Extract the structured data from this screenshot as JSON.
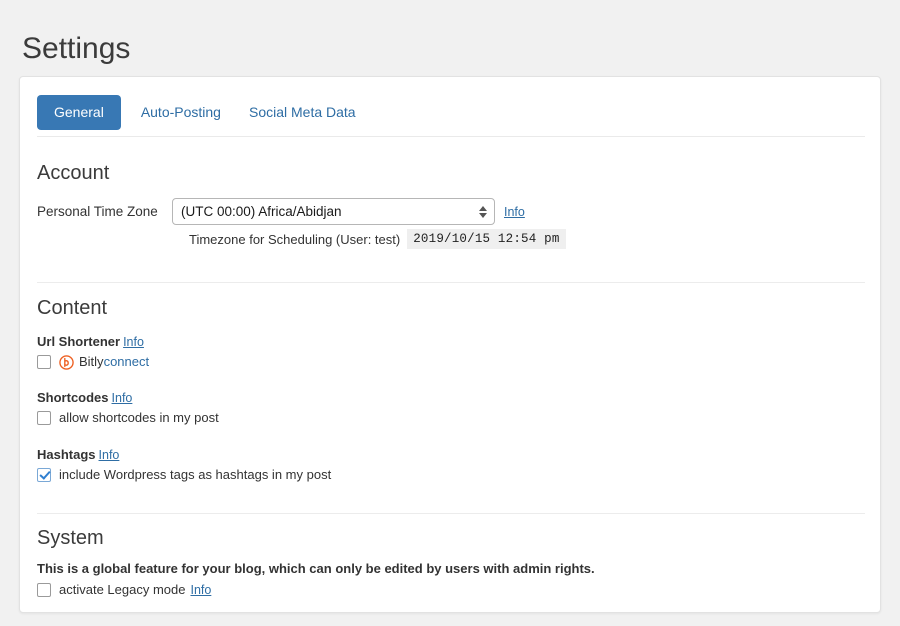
{
  "page": {
    "title": "Settings"
  },
  "tabs": [
    {
      "label": "General",
      "active": true
    },
    {
      "label": "Auto-Posting",
      "active": false
    },
    {
      "label": "Social Meta Data",
      "active": false
    }
  ],
  "sections": {
    "account": {
      "title": "Account",
      "timezone": {
        "label": "Personal Time Zone",
        "selected": "(UTC 00:00) Africa/Abidjan",
        "info_label": "Info",
        "note_text": "Timezone for Scheduling (User: test)",
        "note_value": "2019/10/15 12:54 pm"
      }
    },
    "content": {
      "title": "Content",
      "url_shortener": {
        "heading": "Url Shortener",
        "info_label": "Info",
        "checked": false,
        "provider_name": "Bitly",
        "connect_label": "connect"
      },
      "shortcodes": {
        "heading": "Shortcodes",
        "info_label": "Info",
        "checked": false,
        "checkbox_label": "allow shortcodes in my post"
      },
      "hashtags": {
        "heading": "Hashtags",
        "info_label": "Info",
        "checked": true,
        "checkbox_label": "include Wordpress tags as hashtags in my post"
      }
    },
    "system": {
      "title": "System",
      "note": "This is a global feature for your blog, which can only be edited by users with admin rights.",
      "legacy": {
        "checked": false,
        "checkbox_label": "activate Legacy mode",
        "info_label": "Info"
      }
    }
  },
  "colors": {
    "accent_blue": "#3878b4",
    "link_blue": "#2e6da4",
    "bitly_orange": "#ee6123",
    "page_background": "#f1f1f1",
    "card_background": "#ffffff"
  }
}
